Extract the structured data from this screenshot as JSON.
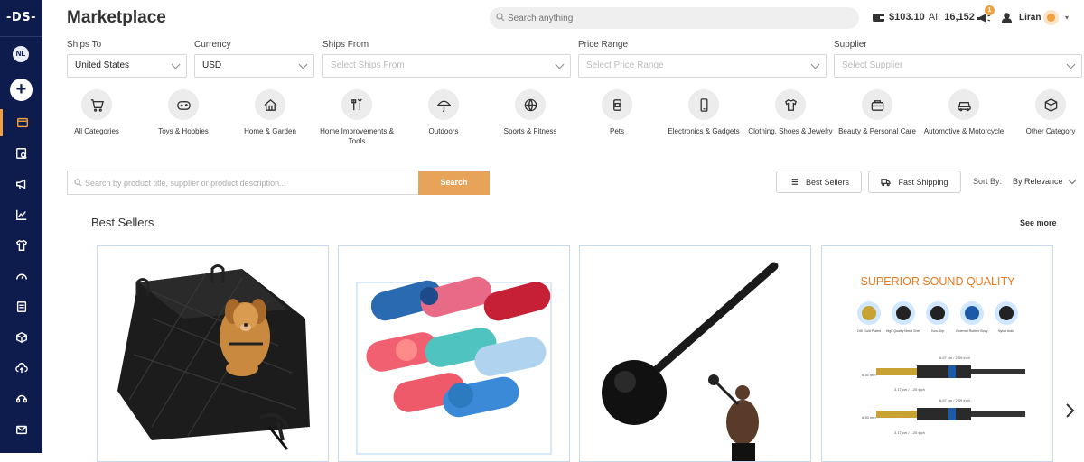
{
  "sidebar": {
    "logo": "-DS-",
    "user_badge": "NL",
    "add_label": "+",
    "items": [
      "store-icon",
      "catalog-icon",
      "megaphone-icon",
      "chart-icon",
      "shirt-icon",
      "gauge-icon",
      "document-icon",
      "box-icon",
      "cloud-upload-icon",
      "support-icon",
      "mail-icon"
    ],
    "active_color": "#f0a040"
  },
  "header": {
    "title": "Marketplace",
    "search_placeholder": "Search anything",
    "balance": "$103.10",
    "ai_label": "AI:",
    "ai_credits": "16,152",
    "notifications": "1",
    "user_name": "Liran"
  },
  "filters": {
    "ships_to": {
      "label": "Ships To",
      "value": "United States"
    },
    "currency": {
      "label": "Currency",
      "value": "USD"
    },
    "ships_from": {
      "label": "Ships From",
      "placeholder": "Select Ships From"
    },
    "price_range": {
      "label": "Price Range",
      "placeholder": "Select Price Range"
    },
    "supplier": {
      "label": "Supplier",
      "placeholder": "Select Supplier"
    }
  },
  "categories": [
    {
      "label": "All Categories",
      "icon": "cart-icon"
    },
    {
      "label": "Toys & Hobbies",
      "icon": "gamepad-icon"
    },
    {
      "label": "Home & Garden",
      "icon": "house-icon"
    },
    {
      "label": "Home Improvements & Tools",
      "icon": "tools-icon"
    },
    {
      "label": "Outdoors",
      "icon": "umbrella-icon"
    },
    {
      "label": "Sports & Fitness",
      "icon": "basketball-icon"
    },
    {
      "label": "Pets",
      "icon": "pet-food-icon"
    },
    {
      "label": "Electronics & Gadgets",
      "icon": "phone-icon"
    },
    {
      "label": "Clothing, Shoes & Jewelry",
      "icon": "shirt-icon"
    },
    {
      "label": "Beauty & Personal Care",
      "icon": "beauty-case-icon"
    },
    {
      "label": "Automotive & Motorcycle",
      "icon": "car-icon"
    },
    {
      "label": "Other Category",
      "icon": "box-icon"
    }
  ],
  "product_search": {
    "placeholder": "Search by product title, supplier or product description...",
    "button": "Search",
    "best_sellers": "Best Sellers",
    "fast_shipping": "Fast Shipping",
    "sort_label": "Sort By:",
    "sort_value": "By Relevance"
  },
  "section": {
    "title": "Best Sellers",
    "see_more": "See more"
  },
  "products": [
    {
      "image": "dog-car-seat-cover"
    },
    {
      "image": "water-bottle-rack"
    },
    {
      "image": "steel-mace"
    },
    {
      "image": "audio-cable",
      "headline": "SUPERIOR SOUND QUALITY",
      "features": [
        "24K Gold Plated",
        "High Quality Metal Shell",
        "Non-Slip",
        "External Rubber Body",
        "Nylon braid"
      ],
      "dim_top": "6.67 cm / 2.59 inch",
      "dim_bottom": "3.17 cm / 1.25 inch",
      "plug_label": "6.35 mm"
    }
  ],
  "colors": {
    "accent": "#e8a35a",
    "sidebar": "#0e1b4d",
    "card_border": "#c9dbf0"
  }
}
